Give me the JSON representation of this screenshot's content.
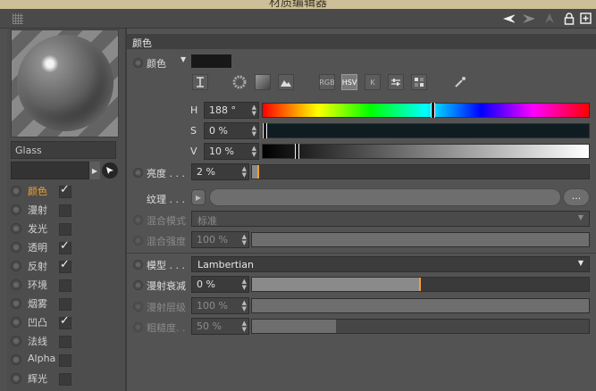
{
  "window": {
    "title": "材质编辑器"
  },
  "toolbar": {
    "icons": [
      "arrow-left-icon",
      "arrow-right-icon",
      "up-icon",
      "lock-icon",
      "new-window-icon"
    ]
  },
  "material": {
    "name": "Glass"
  },
  "channels": [
    {
      "label": "颜色",
      "checked": true,
      "active": true
    },
    {
      "label": "漫射",
      "checked": false
    },
    {
      "label": "发光",
      "checked": false
    },
    {
      "label": "透明",
      "checked": true
    },
    {
      "label": "反射",
      "checked": true
    },
    {
      "label": "环境",
      "checked": false
    },
    {
      "label": "烟雾",
      "checked": false
    },
    {
      "label": "凹凸",
      "checked": true
    },
    {
      "label": "法线",
      "checked": false
    },
    {
      "label": "Alpha",
      "checked": false
    },
    {
      "label": "辉光",
      "checked": false
    }
  ],
  "section": {
    "title": "颜色"
  },
  "color": {
    "label": "颜色",
    "swatch": "#181818",
    "modes": [
      "RGB",
      "HSV",
      "K"
    ],
    "active_mode": "HSV",
    "h": {
      "label": "H",
      "value": "188 °",
      "fraction": 0.522
    },
    "s": {
      "label": "S",
      "value": "0 %",
      "fraction": 0.0
    },
    "v": {
      "label": "V",
      "value": "10 %",
      "fraction": 0.1
    }
  },
  "brightness": {
    "label": "亮度 . . .",
    "value": "2 %",
    "fraction": 0.02
  },
  "texture": {
    "label": "纹理 . . .",
    "more": "..."
  },
  "blend_mode": {
    "label": "混合模式",
    "value": "标准"
  },
  "blend_strength": {
    "label": "混合强度",
    "value": "100 %",
    "fraction": 1.0
  },
  "model": {
    "label": "模型 . . .",
    "value": "Lambertian"
  },
  "diffuse_falloff": {
    "label": "漫射衰减",
    "value": "0 %",
    "fraction": 0.5
  },
  "diffuse_level": {
    "label": "漫射层级",
    "value": "100 %",
    "fraction": 1.0
  },
  "roughness": {
    "label": "粗糙度. .",
    "value": "50 %",
    "fraction": 0.25
  }
}
